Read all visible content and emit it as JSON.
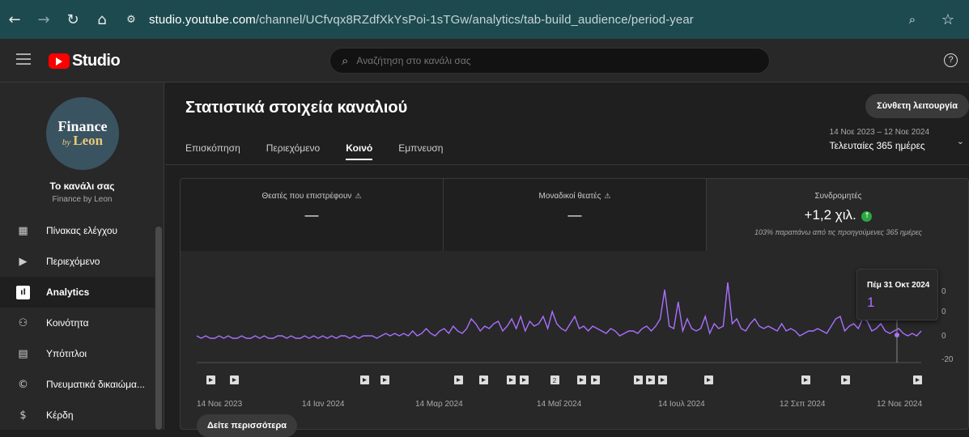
{
  "browser": {
    "url_host": "studio.youtube.com",
    "url_path": "/channel/UCfvqx8RZdfXkYsPoi-1sTGw/analytics/tab-build_audience/period-year"
  },
  "header": {
    "logo_text": "Studio",
    "search_placeholder": "Αναζήτηση στο κανάλι σας"
  },
  "sidebar": {
    "avatar_line1": "Finance",
    "avatar_by": "by",
    "avatar_line2": "Leon",
    "channel_title": "Το κανάλι σας",
    "channel_name": "Finance by Leon",
    "items": [
      {
        "label": "Πίνακας ελέγχου",
        "icon": "dashboard-icon"
      },
      {
        "label": "Περιεχόμενο",
        "icon": "content-icon"
      },
      {
        "label": "Analytics",
        "icon": "analytics-icon"
      },
      {
        "label": "Κοινότητα",
        "icon": "community-icon"
      },
      {
        "label": "Υπότιτλοι",
        "icon": "subtitles-icon"
      },
      {
        "label": "Πνευματικά δικαιώμα...",
        "icon": "copyright-icon"
      },
      {
        "label": "Κέρδη",
        "icon": "earn-icon"
      }
    ]
  },
  "main": {
    "title": "Στατιστικά στοιχεία καναλιού",
    "advanced_label": "Σύνθετη λειτουργία",
    "tabs": [
      "Επισκόπηση",
      "Περιεχόμενο",
      "Κοινό",
      "Εμπνευση"
    ],
    "active_tab": 2,
    "date_sub": "14 Νοε 2023 – 12 Νοε 2024",
    "date_main": "Τελευταίες 365 ημέρες",
    "metrics": [
      {
        "label": "Θεατές που επιστρέφουν",
        "value": "—"
      },
      {
        "label": "Μοναδικοί θεατές",
        "value": "—"
      },
      {
        "label": "Συνδρομητές",
        "value": "+1,2 χιλ.",
        "sub": "103% παραπάνω από τις προηγούμενες 365 ημέρες"
      }
    ],
    "tooltip": {
      "date": "Πέμ 31 Οκτ 2024",
      "value": "1"
    },
    "see_more": "Δείτε περισσότερα"
  },
  "chart_data": {
    "type": "line",
    "series_color": "#a970ff",
    "y_ticks": [
      "0",
      "0",
      "0",
      "-20"
    ],
    "x_labels": [
      "14 Νοε 2023",
      "14 Ιαν 2024",
      "14 Μαρ 2024",
      "14 Μαΐ 2024",
      "14 Ιουλ 2024",
      "12 Σεπ 2024",
      "12 Νοε 2024"
    ],
    "values": [
      1,
      0,
      1,
      0,
      0,
      1,
      0,
      1,
      0,
      0,
      1,
      0,
      0,
      1,
      0,
      1,
      0,
      0,
      1,
      1,
      0,
      1,
      0,
      0,
      1,
      0,
      1,
      0,
      1,
      0,
      1,
      0,
      1,
      1,
      0,
      1,
      0,
      1,
      1,
      1,
      0,
      1,
      2,
      1,
      2,
      1,
      2,
      1,
      3,
      1,
      2,
      4,
      2,
      1,
      3,
      4,
      2,
      5,
      3,
      2,
      4,
      8,
      6,
      3,
      5,
      4,
      6,
      7,
      3,
      5,
      8,
      4,
      9,
      3,
      7,
      5,
      6,
      9,
      4,
      11,
      6,
      4,
      3,
      6,
      9,
      4,
      5,
      3,
      5,
      4,
      3,
      2,
      4,
      3,
      1,
      2,
      3,
      3,
      2,
      4,
      5,
      3,
      5,
      8,
      20,
      5,
      4,
      15,
      3,
      8,
      4,
      3,
      4,
      9,
      2,
      6,
      4,
      5,
      23,
      6,
      8,
      4,
      3,
      6,
      8,
      5,
      4,
      5,
      4,
      3,
      6,
      3,
      4,
      3,
      1,
      2,
      3,
      3,
      4,
      3,
      2,
      5,
      8,
      9,
      3,
      5,
      6,
      4,
      8,
      7,
      3,
      4,
      6,
      3,
      2,
      3,
      4,
      2,
      1,
      2,
      1,
      3
    ],
    "markers": [
      "play",
      "play",
      "play",
      "play",
      "play",
      "play",
      "play",
      "play",
      "count-2",
      "play",
      "play",
      "play",
      "play",
      "play",
      "play",
      "play",
      "play",
      "play",
      "play"
    ]
  }
}
